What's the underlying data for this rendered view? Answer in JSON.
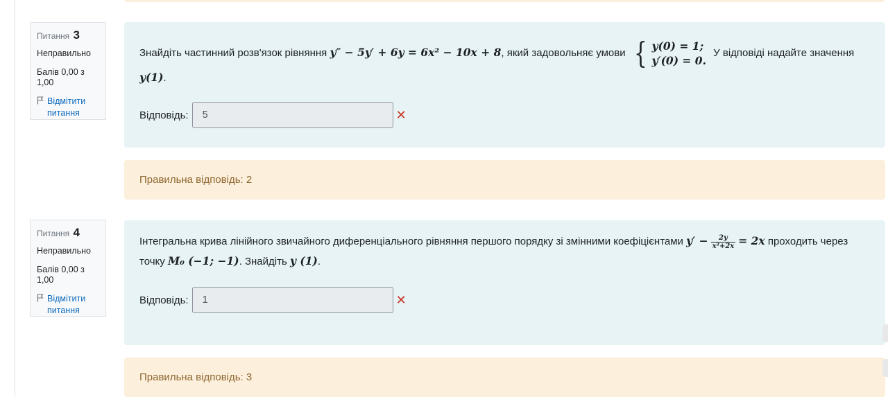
{
  "questions": [
    {
      "qno_label": "Питання",
      "qno": "3",
      "state": "Неправильно",
      "grade": "Балів 0,00 з 1,00",
      "flag_label": "Відмітити питання",
      "text_before": "Знайдіть частинний розв'язок рівняння",
      "equation": "y″ − 5y′ + 6y = 6x² − 10x + 8",
      "text_middle": ", який задовольняє умови",
      "condition_1": "y(0) = 1;",
      "condition_2": "y′(0) = 0.",
      "text_after": "У відповіді надайте значення",
      "target": "y(1)",
      "target_suffix": ".",
      "answer_label": "Відповідь:",
      "answer_value": "5",
      "correct_answer": "Правильна відповідь: 2"
    },
    {
      "qno_label": "Питання",
      "qno": "4",
      "state": "Неправильно",
      "grade": "Балів 0,00 з 1,00",
      "flag_label": "Відмітити питання",
      "text_before": "Інтегральна крива лінійного звичайного диференціального рівняння першого порядку зі змінними коефіцієнтами",
      "eq_left": "y′ −",
      "frac_num": "2y",
      "frac_den": "x²+2x",
      "eq_right": "= 2x",
      "text_middle": "проходить через точку",
      "point": "M₀ (−1; −1)",
      "text_after": ". Знайдіть",
      "target": "y (1)",
      "target_suffix": ".",
      "answer_label": "Відповідь:",
      "answer_value": "1",
      "correct_answer": "Правильна відповідь: 3"
    }
  ],
  "colors": {
    "content_bg": "#e7f3f5",
    "feedback_bg": "#fcefdc",
    "feedback_text": "#8e662e",
    "link": "#0f6cbf",
    "incorrect": "#ca3120"
  },
  "icons": {
    "flag": "flag-icon",
    "wrong": "cross-icon"
  }
}
